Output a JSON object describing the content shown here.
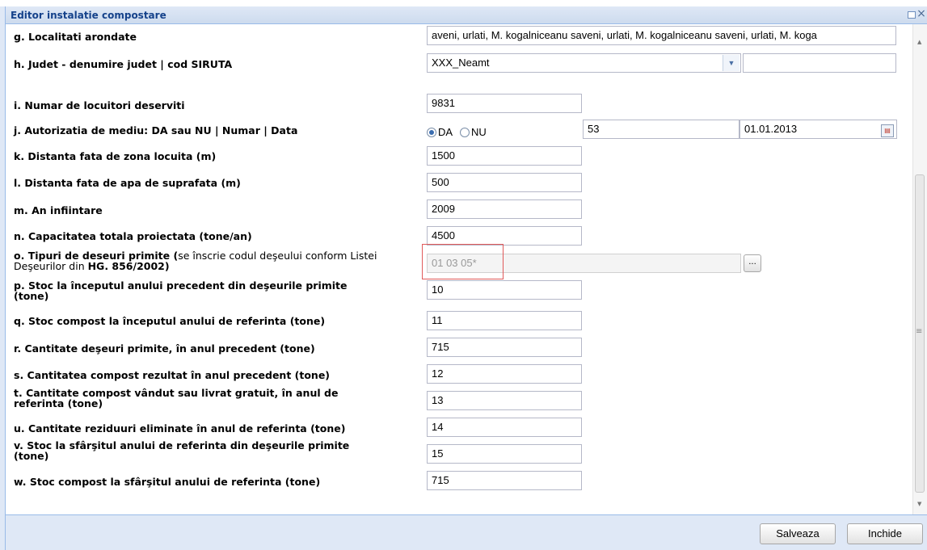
{
  "window": {
    "title": "Editor instalatie compostare"
  },
  "fields": {
    "g": {
      "label": "g. Localitati arondate",
      "value": "aveni, urlati, M. kogalniceanu saveni, urlati, M. kogalniceanu saveni, urlati, M. koga"
    },
    "h": {
      "label": "h. Judet - denumire judet | cod SIRUTA",
      "value": "XXX_Neamt",
      "siruta": ""
    },
    "i": {
      "label": "i. Numar de locuitori deserviti",
      "value": "9831"
    },
    "j": {
      "label": "j. Autorizatia de mediu: DA sau NU | Numar | Data",
      "radio_da": "DA",
      "radio_nu": "NU",
      "selected": "DA",
      "numar": "53",
      "data": "01.01.2013"
    },
    "k": {
      "label": "k. Distanta fata de zona locuita (m)",
      "value": "1500"
    },
    "l": {
      "label": "l. Distanta fata de apa de suprafata (m)",
      "value": "500"
    },
    "m": {
      "label": "m. An infiintare",
      "value": "2009"
    },
    "n": {
      "label": "n. Capacitatea totala proiectata (tone/an)",
      "value": "4500"
    },
    "o": {
      "label_bold": "o. Tipuri de deseuri primite (",
      "label_note": "se înscrie codul deşeului conform Listei",
      "label_line2_a": "Deşeurilor din ",
      "label_line2_b": "HG. 856/2002)",
      "value": "01 03 05*",
      "button": "..."
    },
    "p": {
      "label_1": "p. Stoc la începutul anului precedent din deşeurile primite",
      "label_2": "(tone)",
      "value": "10"
    },
    "q": {
      "label": "q. Stoc compost la începutul anului de referinta (tone)",
      "value": "11"
    },
    "r": {
      "label": "r. Cantitate deşeuri primite, în anul precedent (tone)",
      "value": "715"
    },
    "s": {
      "label": "s. Cantitatea compost rezultat în anul precedent (tone)",
      "value": "12"
    },
    "t": {
      "label_1": "t. Cantitate compost vândut sau livrat gratuit, în anul de",
      "label_2": "referinta (tone)",
      "value": "13"
    },
    "u": {
      "label": "u. Cantitate reziduuri eliminate în anul de referinta (tone)",
      "value": "14"
    },
    "v": {
      "label_1": "v. Stoc la sfârşitul anului de referinta din deşeurile primite",
      "label_2": "(tone)",
      "value": "15"
    },
    "w": {
      "label": "w. Stoc compost la sfârşitul anului de referinta (tone)",
      "value": "715"
    }
  },
  "buttons": {
    "save": "Salveaza",
    "close": "Inchide"
  },
  "colors": {
    "title_text": "#15428b",
    "frame": "#dfe8f6",
    "highlight_border": "#e05a5a"
  }
}
